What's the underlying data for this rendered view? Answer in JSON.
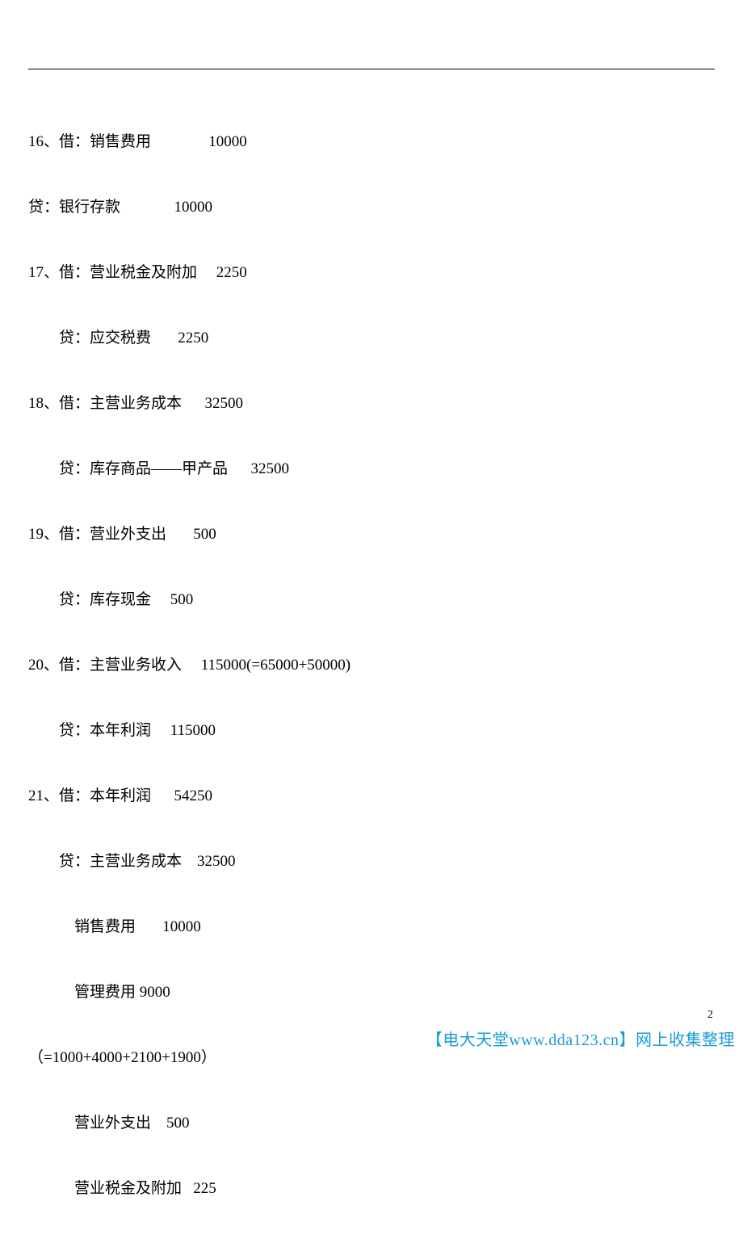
{
  "lines": [
    "16、借：销售费用               10000",
    "贷：银行存款              10000",
    "17、借：营业税金及附加     2250",
    "        贷：应交税费       2250",
    "18、借：主营业务成本      32500",
    "        贷：库存商品——甲产品      32500",
    "19、借：营业外支出       500",
    "        贷：库存现金     500",
    "20、借：主营业务收入     115000(=65000+50000)",
    "        贷：本年利润     115000",
    "21、借：本年利润      54250",
    "        贷：主营业务成本    32500",
    "            销售费用       10000",
    "            管理费用 9000",
    "（=1000+4000+2100+1900）",
    "            营业外支出    500",
    "            营业税金及附加   225"
  ],
  "page_number": "2",
  "footer": "【电大天堂www.dda123.cn】网上收集整理"
}
